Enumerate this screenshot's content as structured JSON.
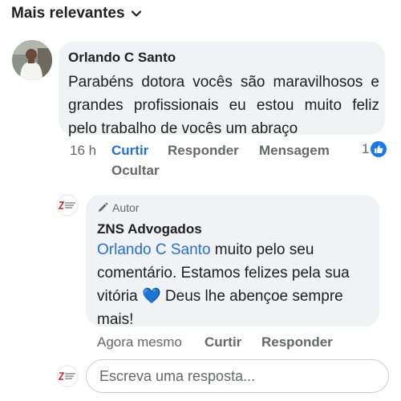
{
  "sort": {
    "label": "Mais relevantes",
    "icon": "chevron-down-icon"
  },
  "comment": {
    "author": "Orlando C Santo",
    "text": "Parabéns dotora vocês são maravilhosos e grandes profissionais eu estou muito feliz pelo trabalho de vocês um abraço",
    "time": "16 h",
    "actions": {
      "like": "Curtir",
      "reply": "Responder",
      "message": "Mensagem",
      "hide": "Ocultar"
    },
    "reaction_count": "1"
  },
  "reply": {
    "badge": "Autor",
    "author": "ZNS Advogados",
    "mention": "Orlando C Santo",
    "text_before_emoji": " muito pelo seu comentário. Estamos felizes pela sua vitória ",
    "text_after_emoji": " Deus lhe abençoe sempre mais!",
    "emoji": "💙",
    "time": "Agora mesmo",
    "actions": {
      "like": "Curtir",
      "reply": "Responder"
    }
  },
  "reply_input": {
    "placeholder": "Escreva uma resposta..."
  },
  "colors": {
    "link": "#216fdb",
    "like_badge": "#1877f2",
    "bubble": "#f0f2f5",
    "muted": "#65676b"
  }
}
